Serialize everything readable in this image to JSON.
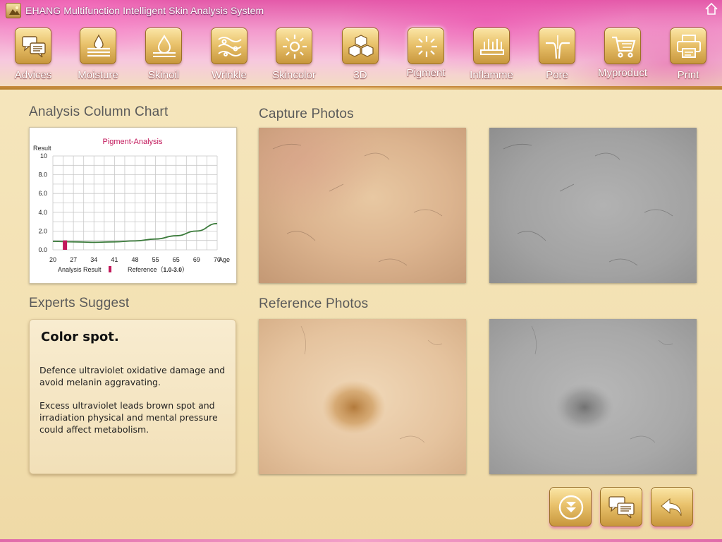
{
  "window": {
    "title": "EHANG Multifunction Intelligent Skin Analysis System"
  },
  "nav": {
    "items": [
      {
        "label": "Advices",
        "icon": "chat-bubbles-icon"
      },
      {
        "label": "Moisture",
        "icon": "water-drop-icon"
      },
      {
        "label": "Skinoil",
        "icon": "oil-drop-icon"
      },
      {
        "label": "Wrinkle",
        "icon": "wrinkle-icon"
      },
      {
        "label": "Skincolor",
        "icon": "sun-icon"
      },
      {
        "label": "3D",
        "icon": "cubes-icon"
      },
      {
        "label": "Pigment",
        "icon": "sparkle-icon"
      },
      {
        "label": "Inflamme",
        "icon": "inflammation-icon"
      },
      {
        "label": "Pore",
        "icon": "pore-icon"
      },
      {
        "label": "Myproduct",
        "icon": "cart-icon"
      },
      {
        "label": "Print",
        "icon": "printer-icon"
      }
    ]
  },
  "sections": {
    "chart_title": "Analysis Column Chart",
    "capture_title": "Capture Photos",
    "experts_title": "Experts Suggest",
    "reference_title": "Reference Photos"
  },
  "chart_data": {
    "type": "line",
    "title": "Pigment-Analysis",
    "ylabel": "Result",
    "xlabel": "Age",
    "x_ticks": [
      "20",
      "27",
      "34",
      "41",
      "48",
      "55",
      "65",
      "69",
      "70"
    ],
    "y_ticks": [
      "10",
      "8.0",
      "6.0",
      "4.0",
      "2.0",
      "0.0"
    ],
    "ylim": [
      0,
      10
    ],
    "grid": true,
    "series": [
      {
        "type": "line",
        "color": "#3a7a3a",
        "values": [
          0.9,
          0.85,
          0.8,
          0.85,
          0.95,
          1.15,
          1.5,
          2.0,
          2.8
        ]
      },
      {
        "type": "bar",
        "color": "#c2185b",
        "at": "27",
        "value": 1.0
      }
    ],
    "legend": {
      "analysis_result": "Analysis Result",
      "reference_label": "Reference（",
      "reference_range": "1.0-3.0",
      "reference_close": "）"
    }
  },
  "experts": {
    "heading": "Color spot.",
    "paragraph1": "Defence ultraviolet oxidative damage and avoid melanin aggravating.",
    "paragraph2": "Excess ultraviolet leads brown spot and irradiation  physical and mental pressure could affect metabolism."
  },
  "bottom_buttons": [
    {
      "icon": "download-arrow-icon"
    },
    {
      "icon": "chat-bubbles-icon"
    },
    {
      "icon": "back-arrow-icon"
    }
  ],
  "colors": {
    "banner_pink": "#e45aa9",
    "button_gold": "#e9c26c",
    "background_cream": "#f3e1b3",
    "chart_title_red": "#c2185b",
    "curve_green": "#3a7a3a"
  }
}
